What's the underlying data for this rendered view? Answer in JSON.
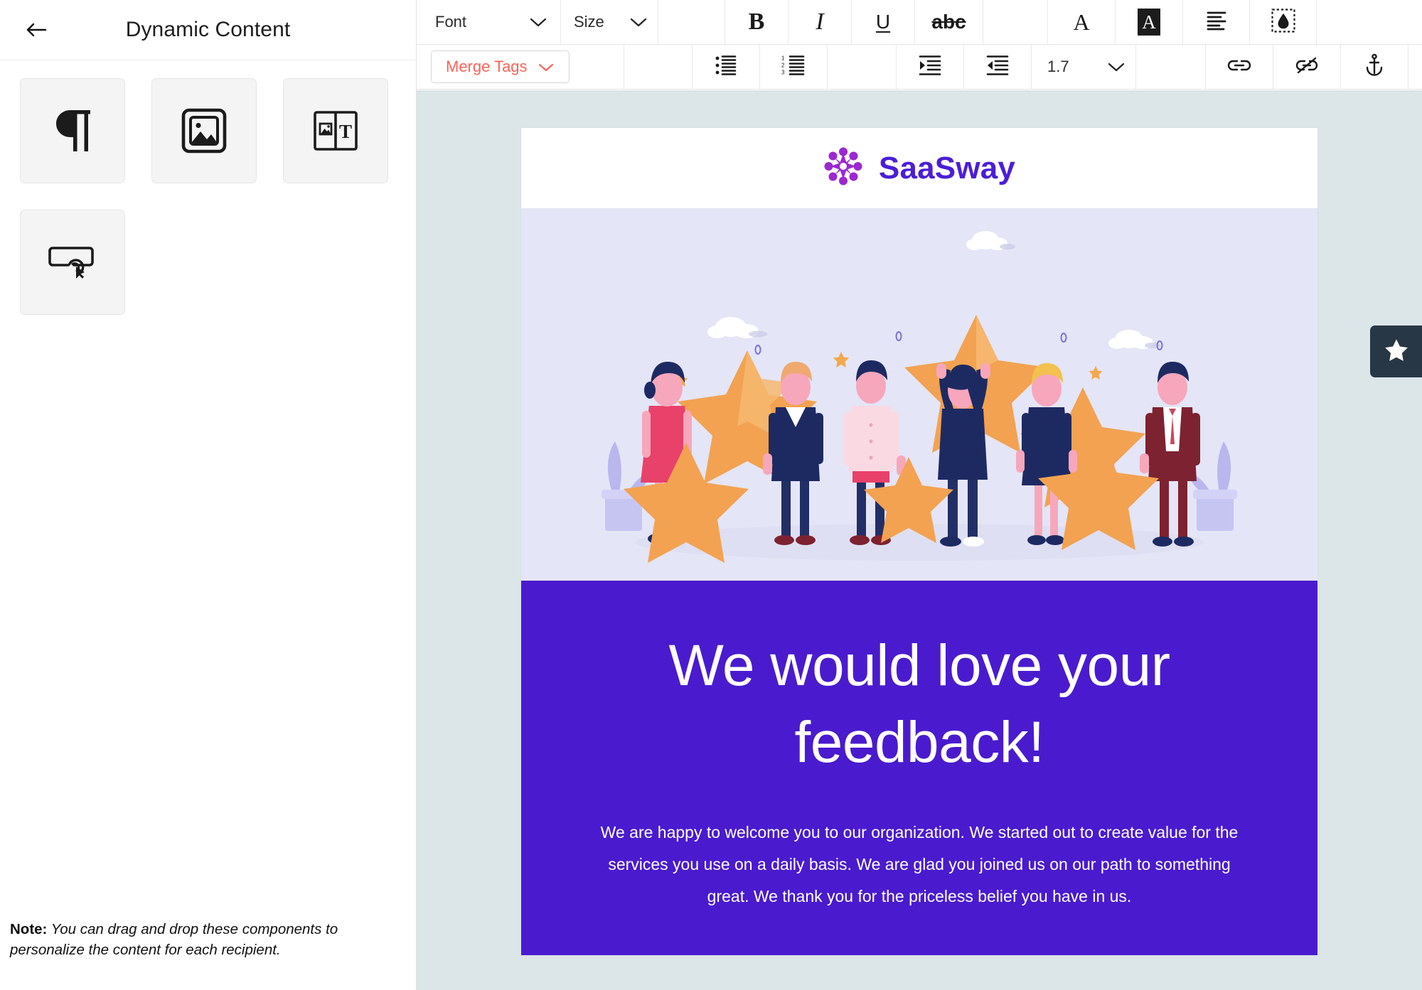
{
  "left_panel": {
    "title": "Dynamic Content",
    "back_icon": "back-arrow-icon",
    "tiles": [
      {
        "name": "paragraph-block",
        "icon": "pilcrow-icon"
      },
      {
        "name": "image-block",
        "icon": "image-icon"
      },
      {
        "name": "image-text-block",
        "icon": "image-text-split-icon"
      },
      {
        "name": "button-block",
        "icon": "button-click-icon"
      }
    ],
    "note_label": "Note:",
    "note_text": " You can drag and drop these components to personalize the content for each recipient."
  },
  "toolbar": {
    "row1": {
      "font_label": "Font",
      "size_label": "Size",
      "bold_label": "B",
      "italic_label": "I",
      "underline_label": "U",
      "strikethrough_label": "abc",
      "font_color_label": "A",
      "background_color_label": "A",
      "align_icon": "align-left-icon",
      "fill_icon": "paint-fill-icon"
    },
    "row2": {
      "merge_tags_label": "Merge Tags",
      "bullet_list_icon": "bullet-list-icon",
      "numbered_list_icon": "numbered-list-icon",
      "indent_icon": "indent-increase-icon",
      "outdent_icon": "indent-decrease-icon",
      "line_height_value": "1.7",
      "link_icon": "link-icon",
      "unlink_icon": "unlink-icon",
      "anchor_icon": "anchor-icon"
    }
  },
  "email": {
    "brand_name": "SaaSway",
    "logo_icon": "flower-logo-icon",
    "hero_illustration": "people-holding-stars-illustration",
    "heading": "We would love your feedback!",
    "body": "We are happy to welcome you to our organization. We started out to create value for the services you use on a daily basis. We are glad you joined us on our path to something great. We thank you for the priceless belief you have in us."
  },
  "side_tab": {
    "icon": "star-icon"
  },
  "colors": {
    "brand_purple": "#4b1ed6",
    "block_purple": "#4a1bce",
    "logo_flower": "#9b28d0",
    "merge_tags_red": "#fc635a",
    "canvas_bg": "#dce5e8",
    "hero_bg": "#e4e5f6",
    "side_tab_bg": "#283745"
  }
}
